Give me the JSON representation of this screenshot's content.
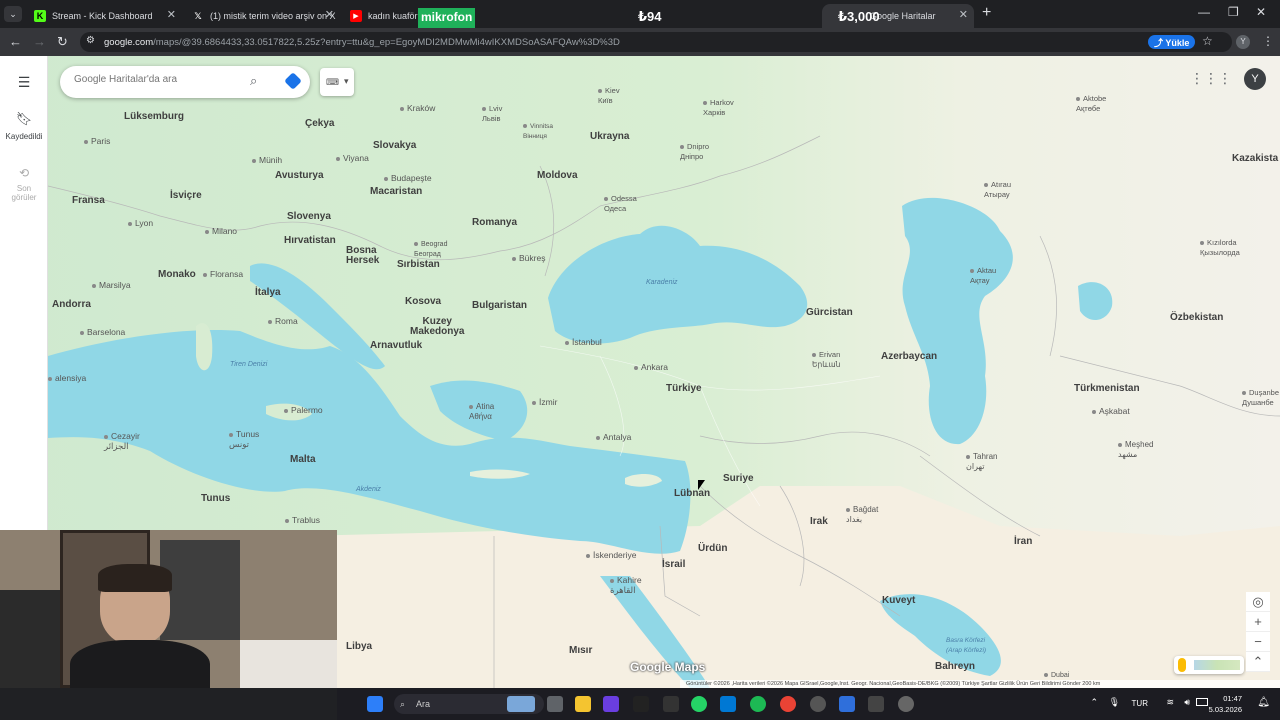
{
  "browser": {
    "tabs": [
      {
        "title": "Stream - Kick Dashboard",
        "icon": "kick-icon",
        "color": "#53fc18"
      },
      {
        "title": "(1) mistik terim video arşiv on X",
        "icon": "x-icon",
        "color": "#000000"
      },
      {
        "title": "kadın kuaförü",
        "icon": "youtube-icon",
        "color": "#ff0000"
      },
      {
        "title": "Google Haritalar",
        "icon": "maps-icon",
        "color": "#34a853",
        "active": true
      }
    ],
    "url_host": "google.com",
    "url_path": "/maps/@39.6864433,33.0517822,5.25z?entry=ttu&g_ep=EgoyMDI2MDMwMi4wIKXMDSoASAFQAw%3D%3D",
    "upload_button": "Yükle",
    "profile_initial": "Y"
  },
  "stream_overlay": {
    "mikrofon": "mikrofon",
    "price_left": "₺94",
    "price_right": "₺3,000"
  },
  "maps": {
    "search_placeholder": "Google Haritalar'da ara",
    "rail": {
      "saved": "Kaydedildi",
      "recent": "Son\ngörüler"
    },
    "profile_initial": "Y",
    "logo": "Google Maps",
    "footer": "Görüntüler ©2026 ,Harita verileri ©2026 Mapa GISrael,Google,Inst. Geogr. Nacional,GeoBasis-DE/BKG (©2009)   Türkiye   Şartlar   Gizlilik   Ürün Geri Bildirimi Gönder   200 km",
    "labels": {
      "luksemburg": "Lüksemburg",
      "paris": "Paris",
      "fransa": "Fransa",
      "lyon": "Lyon",
      "isvicre": "İsviçre",
      "milano": "Milano",
      "monako": "Monako",
      "marsilya": "Marsilya",
      "andorra": "Andorra",
      "barselona": "Barselona",
      "valensiya": "alensiya",
      "cekya": "Çekya",
      "krakow": "Kraków",
      "munih": "Münih",
      "viyana": "Viyana",
      "avusturya": "Avusturya",
      "slovakya": "Slovakya",
      "budapeste": "Budapeşte",
      "macaristan": "Macaristan",
      "slovenya": "Slovenya",
      "hirvatistan": "Hırvatistan",
      "floransa": "Floransa",
      "italya": "İtalya",
      "roma": "Roma",
      "bosna": "Bosna\nHersek",
      "belgrad": "Beograd\nБеоград",
      "sirbistan": "Sırbistan",
      "kosova": "Kosova",
      "kuzeymakedonya": "Kuzey\nMakedonya",
      "arnavutluk": "Arnavutluk",
      "tiren": "Tiren Denizi",
      "palermo": "Palermo",
      "cezayir": "Cezayir\nالجزائر",
      "tunus_city": "Tunus\nتونس",
      "malta": "Malta",
      "tunus": "Tunus",
      "trablus": "Trablus",
      "libya": "Libya",
      "akdeniz": "Akdeniz",
      "lviv": "Lviv\nЛьвів",
      "kiev": "Kiev\nКиїв",
      "vinnitsa": "Vinnitsa\nВінниця",
      "ukrayna": "Ukrayna",
      "harkov": "Harkov\nХарків",
      "dnipro": "Dnipro\nДніпро",
      "moldova": "Moldova",
      "romanya": "Romanya",
      "odessa": "Odessa\nОдеса",
      "bukres": "Bükreş",
      "bulgaristan": "Bulgaristan",
      "karadeniz": "Karadeniz",
      "istanbul": "İstanbul",
      "atina": "Atina\nΑθήνα",
      "izmir": "İzmir",
      "ankara": "Ankara",
      "turkiye": "Türkiye",
      "antalya": "Antalya",
      "gurcistan": "Gürcistan",
      "erivan": "Erivan\nԵրևան",
      "azerbaycan": "Azerbaycan",
      "suriye": "Suriye",
      "lubnan": "Lübnan",
      "irak": "Irak",
      "bagdat": "Bağdat\nبغداد",
      "urdun": "Ürdün",
      "israil": "İsrail",
      "iskenderiye": "İskenderiye",
      "kahire": "Kahire\nالقاهرة",
      "misir": "Mısır",
      "kuveyt": "Kuveyt",
      "iran": "İran",
      "tahran": "Tahran\nتهران",
      "bahreyn": "Bahreyn",
      "basra": "Basra Körfezi\n(Arap Körfezi)",
      "dubai": "Dubai",
      "aktobe": "Aktobe\nАқтөбе",
      "kazakistan": "Kazakista",
      "atirau": "Atırau\nАтырау",
      "kizilorda": "Kızılorda\nҚызылорда",
      "aktau": "Aktau\nАқтау",
      "ozbekistan": "Özbekistan",
      "turkmenistan": "Türkmenistan",
      "askabat": "Aşkabat",
      "duşanbe": "Duşanbe\nДушанбе",
      "meshed": "Meşhed\nمشهد"
    }
  },
  "taskbar": {
    "search": "Ara",
    "lang": "TUR",
    "time": "01:47",
    "date": "5.03.2026"
  }
}
